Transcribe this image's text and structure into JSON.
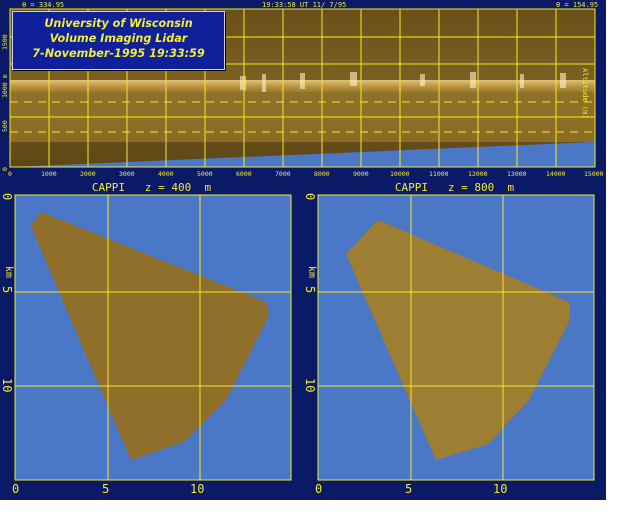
{
  "rhi": {
    "left_angle": "θ = 334.95",
    "timestamp": "19:33:58 UT 11/ 7/95",
    "right_angle": "θ = 154.95",
    "title": [
      "University of Wisconsin",
      "Volume Imaging Lidar",
      "7-November-1995 19:33:59"
    ],
    "y_ticks": [
      "0",
      "500",
      "1000 m",
      "1500"
    ],
    "x_ticks": [
      "0",
      "1000",
      "2000",
      "3000",
      "4000",
      "5000",
      "6000",
      "7000",
      "8000",
      "9000",
      "10000",
      "11000",
      "12000",
      "13000",
      "14000",
      "15000"
    ],
    "right_label": "Altitude (m)"
  },
  "cappi": [
    {
      "title": "CAPPI   z = 400  m",
      "x_ticks": [
        "0",
        "5",
        "10"
      ],
      "y_ticks": [
        "0",
        "5",
        "10"
      ],
      "y_unit": "km"
    },
    {
      "title": "CAPPI   z = 800  m",
      "x_ticks": [
        "0",
        "5",
        "10"
      ],
      "y_ticks": [
        "0",
        "5",
        "10"
      ],
      "y_unit": "km"
    }
  ],
  "colors": {
    "sky": "#4a77c6",
    "backscatter": "#8a6a28",
    "grid": "#f2ea2a",
    "frame": "#0b1a66"
  }
}
